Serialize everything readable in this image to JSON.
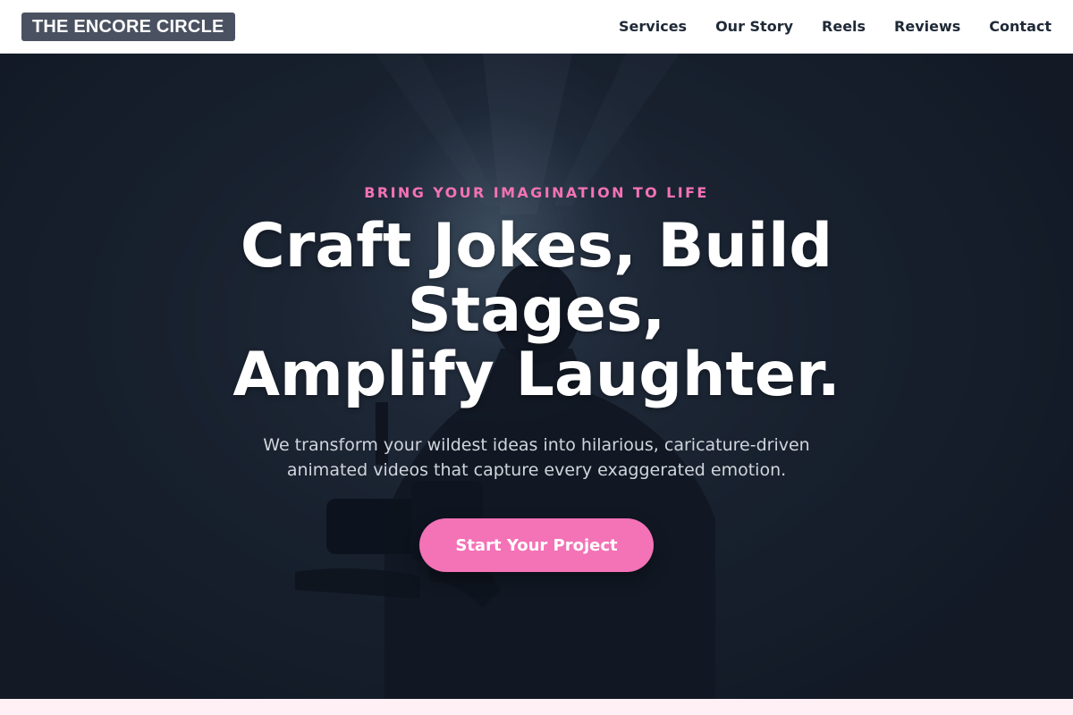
{
  "brand": {
    "name": "THE ENCORE CIRCLE"
  },
  "nav": {
    "items": [
      {
        "label": "Services"
      },
      {
        "label": "Our Story"
      },
      {
        "label": "Reels"
      },
      {
        "label": "Reviews"
      },
      {
        "label": "Contact"
      }
    ]
  },
  "hero": {
    "eyebrow": "BRING YOUR IMAGINATION TO LIFE",
    "headline_lines": [
      "Craft Jokes, Build",
      "Stages,",
      "Amplify Laughter."
    ],
    "subtext": "We transform your wildest ideas into hilarious, caricature-driven animated videos that capture every exaggerated emotion.",
    "cta_label": "Start Your Project",
    "background_image": "silhouette of a camera operator holding a video camera under a stage spotlight"
  },
  "colors": {
    "accent": "#f472b6",
    "hero_dark": "#1c2632",
    "logo_bg": "#4a5161",
    "page_bg": "#fff0f5"
  }
}
